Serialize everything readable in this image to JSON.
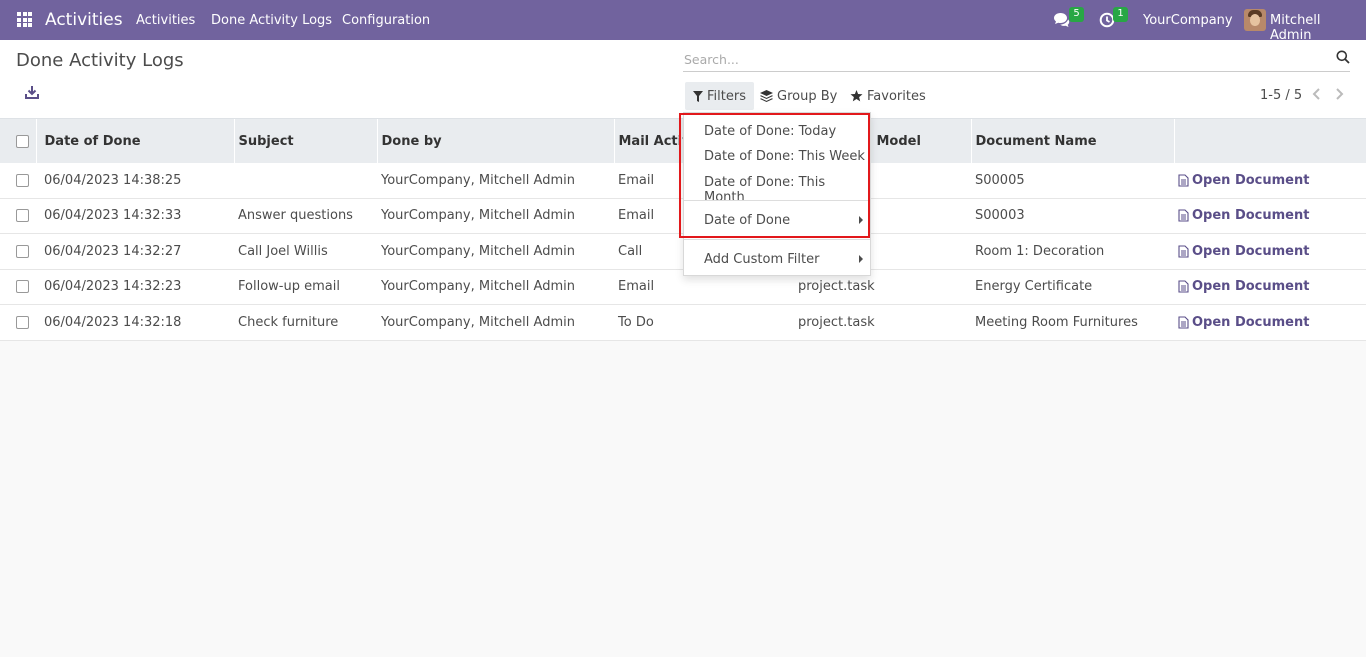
{
  "navbar": {
    "brand": "Activities",
    "menu": [
      "Activities",
      "Done Activity Logs",
      "Configuration"
    ],
    "messages_count": "5",
    "activities_count": "1",
    "company": "YourCompany",
    "user": "Mitchell Admin"
  },
  "control_panel": {
    "title": "Done Activity Logs",
    "search_placeholder": "Search...",
    "filters_label": "Filters",
    "groupby_label": "Group By",
    "favorites_label": "Favorites",
    "pager": "1-5 / 5"
  },
  "filters_dropdown": {
    "items": [
      "Date of Done: Today",
      "Date of Done: This Week",
      "Date of Done: This Month"
    ],
    "date_of_done": "Date of Done",
    "add_custom": "Add Custom Filter"
  },
  "table": {
    "columns": [
      "Date of Done",
      "Subject",
      "Done by",
      "Mail Activity Type",
      "Document Model",
      "Document Name",
      ""
    ],
    "visible_headers": {
      "date": "Date of Done",
      "subject": "Subject",
      "done_by": "Done by",
      "activity_type_partial": "Mail Activit",
      "model_partial": "Model",
      "doc_name": "Document Name"
    },
    "rows": [
      {
        "date": "06/04/2023 14:38:25",
        "subject": "",
        "done_by": "YourCompany, Mitchell Admin",
        "type": "Email",
        "model": "",
        "doc_name": "S00005",
        "action": "Open Document"
      },
      {
        "date": "06/04/2023 14:32:33",
        "subject": "Answer questions",
        "done_by": "YourCompany, Mitchell Admin",
        "type": "Email",
        "model": "",
        "doc_name": "S00003",
        "action": "Open Document"
      },
      {
        "date": "06/04/2023 14:32:27",
        "subject": "Call Joel Willis",
        "done_by": "YourCompany, Mitchell Admin",
        "type": "Call",
        "model": "",
        "doc_name": "Room 1: Decoration",
        "action": "Open Document"
      },
      {
        "date": "06/04/2023 14:32:23",
        "subject": "Follow-up email",
        "done_by": "YourCompany, Mitchell Admin",
        "type": "Email",
        "model": "project.task",
        "doc_name": "Energy Certificate",
        "action": "Open Document"
      },
      {
        "date": "06/04/2023 14:32:18",
        "subject": "Check furniture",
        "done_by": "YourCompany, Mitchell Admin",
        "type": "To Do",
        "model": "project.task",
        "doc_name": "Meeting Room Furnitures",
        "action": "Open Document"
      }
    ]
  },
  "colors": {
    "navbar": "#71639e",
    "link": "#5a4e88",
    "badge": "#28a745",
    "highlight": "#e2181b"
  }
}
